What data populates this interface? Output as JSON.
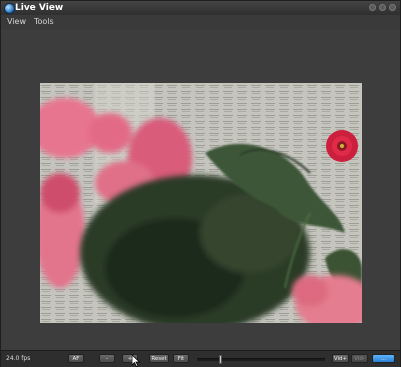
{
  "window": {
    "title": "Live View"
  },
  "menu": [
    "View",
    "Tools"
  ],
  "status": {
    "fps": "24.0 fps"
  },
  "controls": {
    "af": "AF",
    "zoom_out": "-",
    "zoom_in": "+",
    "reset": "Reset",
    "fit": "Fit",
    "vid_plus": "Vid+",
    "vid_minus": "Vid-",
    "last": "..."
  },
  "focus_slider": {
    "value": 0.17
  }
}
